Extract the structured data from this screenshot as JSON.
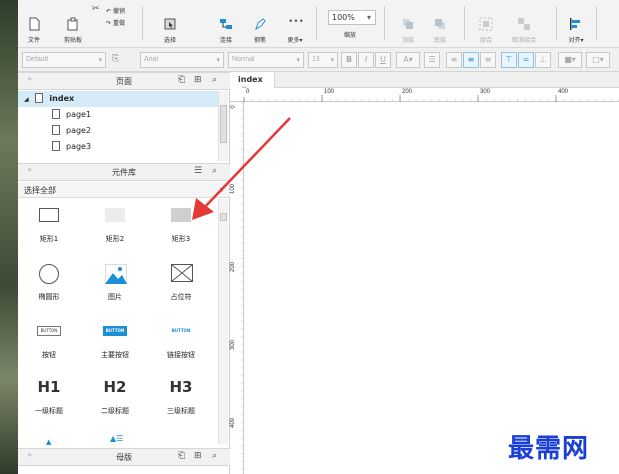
{
  "toolbar": {
    "file": "文件",
    "clipboard": "剪贴板",
    "cut": "剪切",
    "copy": "复制",
    "undo": "撤销",
    "redo": "重做",
    "select": "选择",
    "connect": "连接",
    "pen": "钢笔",
    "more": "更多▾",
    "zoom": "100%",
    "zoom_label": "缩放",
    "top": "顶层",
    "bottom": "底层",
    "group": "组合",
    "ungroup": "取消组合",
    "align": "对齐▾"
  },
  "format": {
    "style": "Default",
    "font": "Arial",
    "weight": "Normal",
    "size": "13"
  },
  "pages": {
    "title": "页面",
    "root": "index",
    "items": [
      "page1",
      "page2",
      "page3"
    ]
  },
  "library": {
    "title": "元件库",
    "filter": "选择全部",
    "widgets": [
      {
        "label": "矩形1"
      },
      {
        "label": "矩形2"
      },
      {
        "label": "矩形3"
      },
      {
        "label": "椭圆形"
      },
      {
        "label": "图片"
      },
      {
        "label": "占位符"
      },
      {
        "label": "按钮",
        "text": "BUTTON"
      },
      {
        "label": "主要按钮",
        "text": "BUTTON"
      },
      {
        "label": "链接按钮",
        "text": "BUTTON"
      },
      {
        "label": "一级标题",
        "text": "H1"
      },
      {
        "label": "二级标题",
        "text": "H2"
      },
      {
        "label": "三级标题",
        "text": "H3"
      }
    ]
  },
  "masters": {
    "title": "母版"
  },
  "canvas": {
    "tab": "index",
    "close": "×",
    "h_ruler": [
      "0",
      "100",
      "200",
      "300",
      "400"
    ],
    "v_ruler": [
      "0",
      "100",
      "200",
      "300",
      "400"
    ]
  },
  "watermark": "最需网",
  "colors": {
    "arrow": "#e53935",
    "accent": "#1a8fd6"
  }
}
